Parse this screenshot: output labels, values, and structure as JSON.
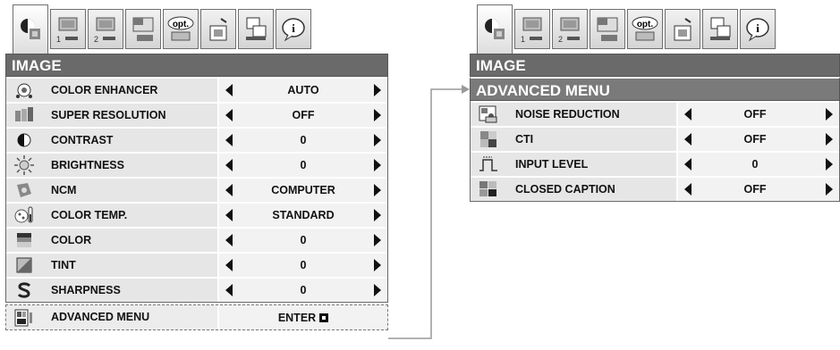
{
  "tabs": [
    {
      "name": "image-tab-icon",
      "label": ""
    },
    {
      "name": "pc-adjust-1-icon",
      "label": "1"
    },
    {
      "name": "pc-adjust-2-icon",
      "label": "2"
    },
    {
      "name": "screen-icon",
      "label": ""
    },
    {
      "name": "option-icon",
      "label": "opt."
    },
    {
      "name": "setup-icon",
      "label": ""
    },
    {
      "name": "network-icon",
      "label": ""
    },
    {
      "name": "info-icon",
      "label": "i"
    }
  ],
  "left": {
    "title": "IMAGE",
    "rows": [
      {
        "icon": "color-enhancer-icon",
        "label": "COLOR ENHANCER",
        "value": "AUTO"
      },
      {
        "icon": "super-resolution-icon",
        "label": "SUPER RESOLUTION",
        "value": "OFF"
      },
      {
        "icon": "contrast-icon",
        "label": "CONTRAST",
        "value": "0"
      },
      {
        "icon": "brightness-icon",
        "label": "BRIGHTNESS",
        "value": "0"
      },
      {
        "icon": "ncm-icon",
        "label": "NCM",
        "value": "COMPUTER"
      },
      {
        "icon": "color-temp-icon",
        "label": "COLOR TEMP.",
        "value": "STANDARD"
      },
      {
        "icon": "color-icon",
        "label": "COLOR",
        "value": "0"
      },
      {
        "icon": "tint-icon",
        "label": "TINT",
        "value": "0"
      },
      {
        "icon": "sharpness-icon",
        "label": "SHARPNESS",
        "value": "0"
      }
    ],
    "advanced": {
      "label": "ADVANCED MENU",
      "value": "ENTER"
    }
  },
  "right": {
    "title": "IMAGE",
    "subtitle": "ADVANCED MENU",
    "rows": [
      {
        "icon": "noise-reduction-icon",
        "label": "NOISE REDUCTION",
        "value": "OFF"
      },
      {
        "icon": "cti-icon",
        "label": "CTI",
        "value": "OFF"
      },
      {
        "icon": "input-level-icon",
        "label": "INPUT LEVEL",
        "value": "0"
      },
      {
        "icon": "closed-caption-icon",
        "label": "CLOSED CAPTION",
        "value": "OFF"
      }
    ]
  }
}
